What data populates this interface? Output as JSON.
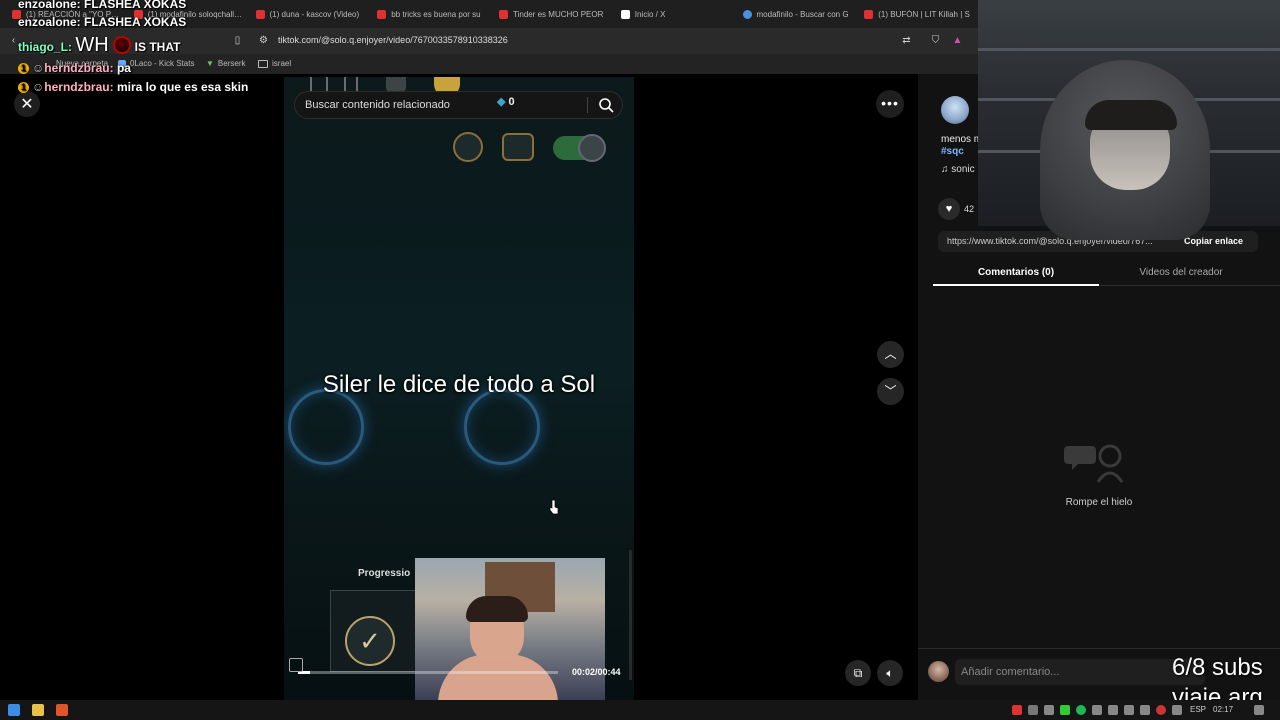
{
  "browser": {
    "tabs": [
      {
        "label": "(1) REACCIÓN a \"YO PRA...",
        "icon_color": "#e03030"
      },
      {
        "label": "(1) modafinilo soloqchallenge",
        "icon_color": "#e03030"
      },
      {
        "label": "(1) duna - kascov (Video)",
        "icon_color": "#e03030"
      },
      {
        "label": "bb tricks es buena por su",
        "icon_color": "#e03030"
      },
      {
        "label": "Tinder es MUCHO PEOR",
        "icon_color": "#e03030"
      },
      {
        "label": "Inicio / X",
        "icon_color": "#ffffff"
      },
      {
        "label": "modafinilo - Buscar con G",
        "icon_color": "#4a90e2"
      },
      {
        "label": "(1) BUFÓN | LIT Killah | S",
        "icon_color": "#e03030"
      }
    ],
    "url": "tiktok.com/@solo.q.enjoyer/video/7670033578910338326",
    "bookmarks": [
      "Nueva carpeta",
      "0Laco - Kick Stats",
      "Berserk",
      "israel"
    ]
  },
  "chat": [
    {
      "user": "enzoalone:",
      "message": "FLASHEA XOKAS"
    },
    {
      "user": "enzoalone:",
      "message": "FLASHEA XOKAS"
    },
    {
      "user": "thiago_L:",
      "message_a": "WH",
      "message_b": "IS THAT"
    },
    {
      "user": "herndzbrau:",
      "message": "pa"
    },
    {
      "user": "herndzbrau:",
      "message": "mira lo que es esa skin"
    }
  ],
  "video": {
    "search_placeholder": "Buscar contenido relacionado",
    "gem_count": "0",
    "caption": "Siler le dice de todo a Sol",
    "progress_label": "Progressio",
    "time": "00:02/00:44",
    "progress_fraction": 0.045
  },
  "side": {
    "description": "menos m",
    "hashtag": "#sqc",
    "music": "sonic",
    "likes": "42",
    "link_url": "https://www.tiktok.com/@solo.q.enjoyer/video/767...",
    "copy_link": "Copiar enlace",
    "tab_comments": "Comentarios (0)",
    "tab_creator": "Videos del creador",
    "empty_text": "Rompe el hielo",
    "comment_placeholder": "Añadir comentario..."
  },
  "overlay": {
    "subs_line1": "6/8 subs",
    "subs_line2": "viaje arg"
  },
  "taskbar": {
    "lang": "ESP",
    "clock": "02:17"
  },
  "colors": {
    "accent_link": "#7fb6ff",
    "toggle_on": "#2e6b3a"
  }
}
